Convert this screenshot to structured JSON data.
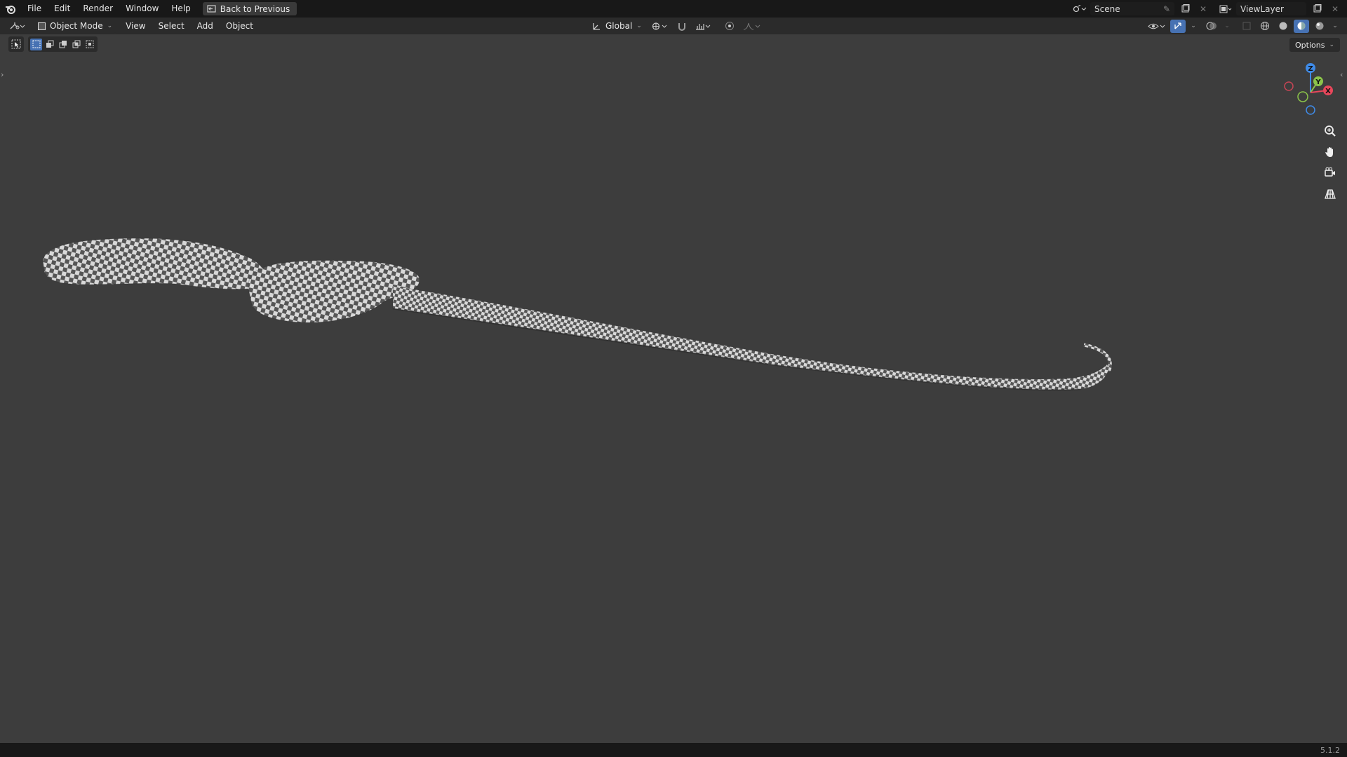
{
  "menu": [
    "File",
    "Edit",
    "Render",
    "Window",
    "Help"
  ],
  "back_button": "Back to Previous",
  "scene": {
    "name": "Scene"
  },
  "view_layer": {
    "name": "ViewLayer"
  },
  "header": {
    "mode": "Object Mode",
    "menus": [
      "View",
      "Select",
      "Add",
      "Object"
    ],
    "transform_orientation": "Global"
  },
  "options_label": "Options",
  "gizmo": {
    "z": "Z",
    "y": "Y",
    "x": "X"
  },
  "status": {
    "version": "5.1.2"
  },
  "colors": {
    "x_axis": "#e8475b",
    "y_axis": "#8bc34a",
    "z_axis": "#3f8be8",
    "viewport_bg": "#3d3d3d"
  }
}
